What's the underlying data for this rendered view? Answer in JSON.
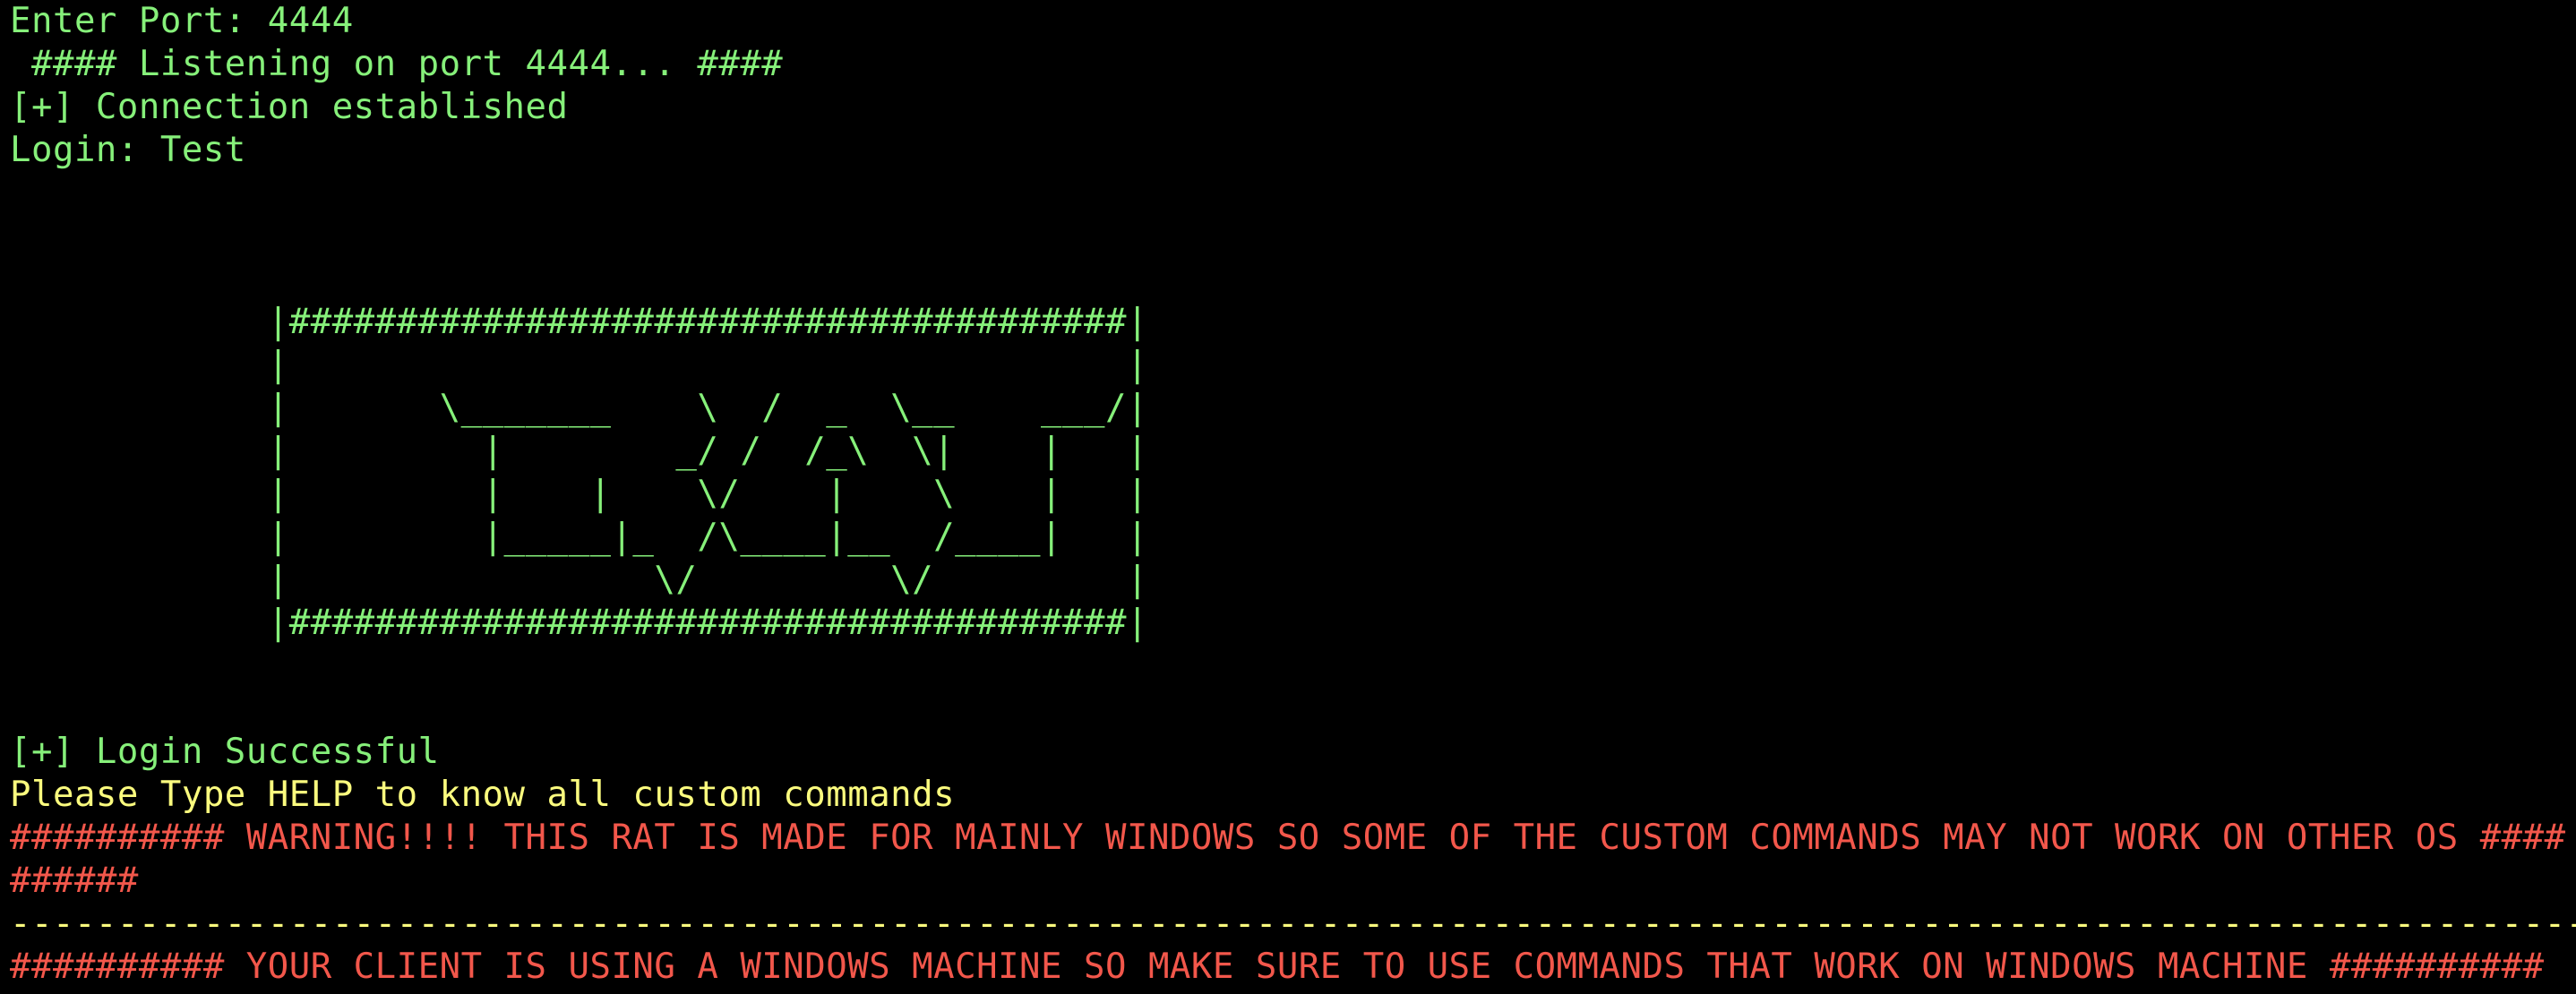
{
  "colors": {
    "background": "#000000",
    "green": "#86f07a",
    "yellow": "#fbfb7e",
    "red": "#f2574b"
  },
  "terminal": {
    "prompt_port": "Enter Port: 4444",
    "listening": " #### Listening on port 4444... ####",
    "connection": "[+] Connection established",
    "login": "Login: Test",
    "banner": [
      "            |#######################################|",
      "            |                                       |",
      "            |       \\_______    \\  /  _  \\__    ___/|",
      "            |         |        _/ /  /_\\  \\|    |   |",
      "            |         |    |    \\/    |    \\    |   |",
      "            |         |_____|_  /\\____|__  /____|   |",
      "            |                 \\/         \\/         |",
      "            |#######################################|"
    ],
    "login_success": "[+] Login Successful",
    "help_hint": "Please Type HELP to know all custom commands",
    "warning_line1": "########## WARNING!!!! THIS RAT IS MADE FOR MAINLY WINDOWS SO SOME OF THE CUSTOM COMMANDS MAY NOT WORK ON OTHER OS ####",
    "warning_line2": "######",
    "separator": "-------------------------------------------------------------------------------------------------------------------------",
    "client_notice": "########## YOUR CLIENT IS USING A WINDOWS MACHINE SO MAKE SURE TO USE COMMANDS THAT WORK ON WINDOWS MACHINE ##########"
  }
}
